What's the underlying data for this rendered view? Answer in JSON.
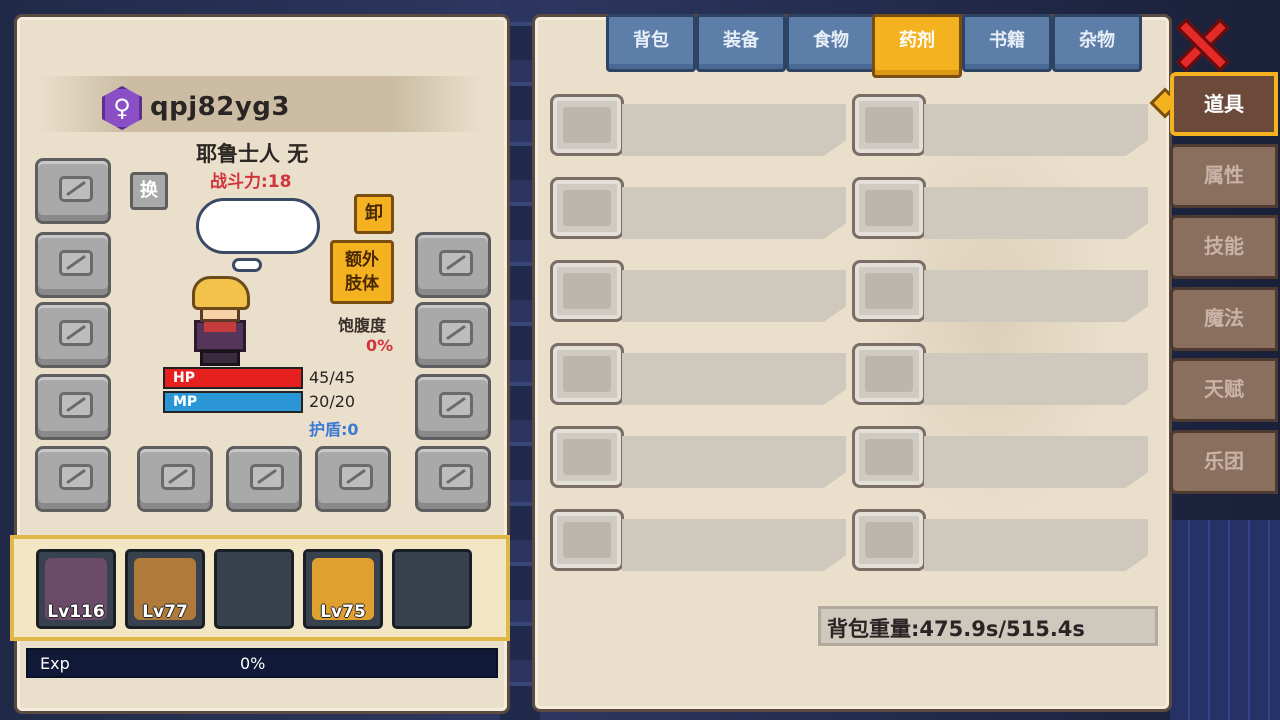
{
  "character": {
    "gender_symbol": "♀",
    "name": "qpj82yg3",
    "title": "耶鲁士人 无",
    "power": "战斗力:18",
    "swap_label": "换",
    "unequip_label": "卸",
    "extra_limb_label_line1": "额外",
    "extra_limb_label_line2": "肢体",
    "satiety_label": "饱腹度",
    "satiety_value": "0%",
    "hp_label": "HP",
    "hp_value": "45/45",
    "hp_fraction": 1.0,
    "mp_label": "MP",
    "mp_value": "20/20",
    "mp_fraction": 1.0,
    "shield": "护盾:0"
  },
  "party": [
    {
      "level": "Lv116",
      "color": "#6b4a6a"
    },
    {
      "level": "Lv77",
      "color": "#b07a3a"
    },
    {
      "level": "",
      "color": ""
    },
    {
      "level": "Lv75",
      "color": "#e0a030"
    },
    {
      "level": "",
      "color": ""
    }
  ],
  "exp": {
    "label": "Exp",
    "value": "0%"
  },
  "inventory": {
    "tabs": [
      "背包",
      "装备",
      "食物",
      "药剂",
      "书籍",
      "杂物"
    ],
    "active_tab": "药剂",
    "weight": "背包重量:475.9s/515.4s"
  },
  "side_menu": {
    "items": [
      "道具",
      "属性",
      "技能",
      "魔法",
      "天赋",
      "乐团"
    ],
    "active": "道具"
  },
  "colors": {
    "accent": "#f4b221",
    "hp": "#e5201f",
    "mp": "#2a96d6",
    "power": "#d2343c",
    "close": "#e52a2a"
  }
}
